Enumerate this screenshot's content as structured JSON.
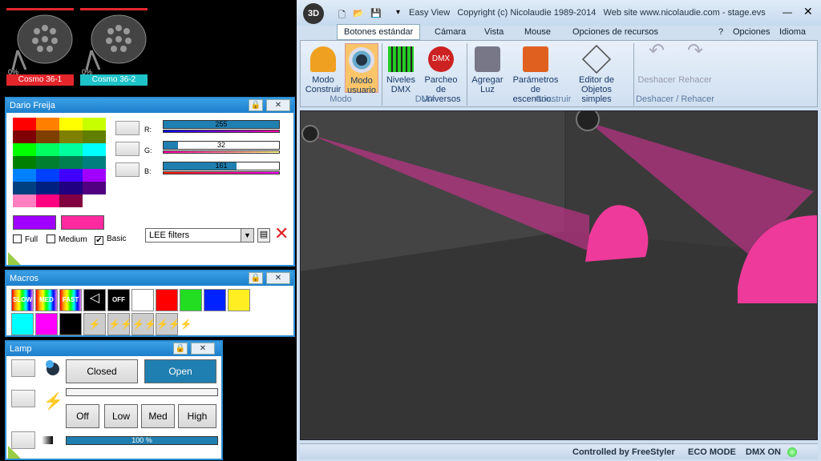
{
  "fixtures": [
    {
      "pct": "0%",
      "label": "Cosmo 36-1",
      "color": "#e4262c"
    },
    {
      "pct": "0%",
      "label": "Cosmo 36-2",
      "color": "#1ec3c9"
    }
  ],
  "color_panel": {
    "title": "Dario Freija",
    "r_label": "R:",
    "g_label": "G:",
    "b_label": "B:",
    "r_value": "255",
    "g_value": "32",
    "b_value": "161",
    "r_frac": 1.0,
    "g_frac": 0.125,
    "b_frac": 0.63,
    "presets": [
      "Full",
      "Medium",
      "Basic"
    ],
    "basic_checked": true,
    "filter_select": "LEE filters",
    "palette": [
      "#ff0000",
      "#ff7f00",
      "#ffff00",
      "#c8ff00",
      "#7f0000",
      "#7f3f00",
      "#7f7f00",
      "#607f00",
      "#00ff00",
      "#00ff60",
      "#00ff9f",
      "#00ffff",
      "#007f00",
      "#007f30",
      "#007f50",
      "#007f7f",
      "#0080ff",
      "#0040ff",
      "#4000ff",
      "#a000ff",
      "#004080",
      "#002080",
      "#200080",
      "#500080",
      "#ff80c0",
      "#ff0080",
      "#800040",
      "#ffffff"
    ],
    "current_colors": [
      "#a000ff",
      "#ff2aa0"
    ]
  },
  "macros_panel": {
    "title": "Macros",
    "row1": [
      "SLOW",
      "MED",
      "FAST",
      "speaker",
      "OFF",
      "#ffffff",
      "#ff0000",
      "#22dd22",
      "#0022ff",
      "#ffee22"
    ],
    "row2": [
      "#00ffff",
      "#ff00ff",
      "#000000",
      "bolt1",
      "bolt2",
      "bolt3",
      "bolt4"
    ]
  },
  "lamp_panel": {
    "title": "Lamp",
    "closed": "Closed",
    "open": "Open",
    "off": "Off",
    "low": "Low",
    "med": "Med",
    "high": "High",
    "dimmer": "100 %"
  },
  "window": {
    "title": "Easy View   Copyright (c) Nicolaudie 1989-2014   Web site www.nicolaudie.com - stage.evs",
    "tabs": [
      "Botones estándar",
      "Cámara",
      "Vista",
      "Mouse",
      "Opciones de recursos"
    ],
    "right_menu": [
      "?",
      "Opciones",
      "Idioma"
    ],
    "buttons": {
      "modo_construir": "Modo Construir",
      "modo_usuario": "Modo usuario",
      "niveles": "Niveles DMX",
      "parcheo": "Parcheo de Universos",
      "agregar": "Agregar Luz",
      "parametros": "Parámetros de escenario...",
      "editor": "Editor de Objetos simples",
      "deshacer": "Deshacer",
      "rehacer": "Rehacer"
    },
    "groups": [
      "Modo",
      "DMX",
      "Construir",
      "Deshacer / Rehacer"
    ],
    "status": [
      "Controlled by FreeStyler",
      "ECO MODE",
      "DMX ON"
    ]
  }
}
